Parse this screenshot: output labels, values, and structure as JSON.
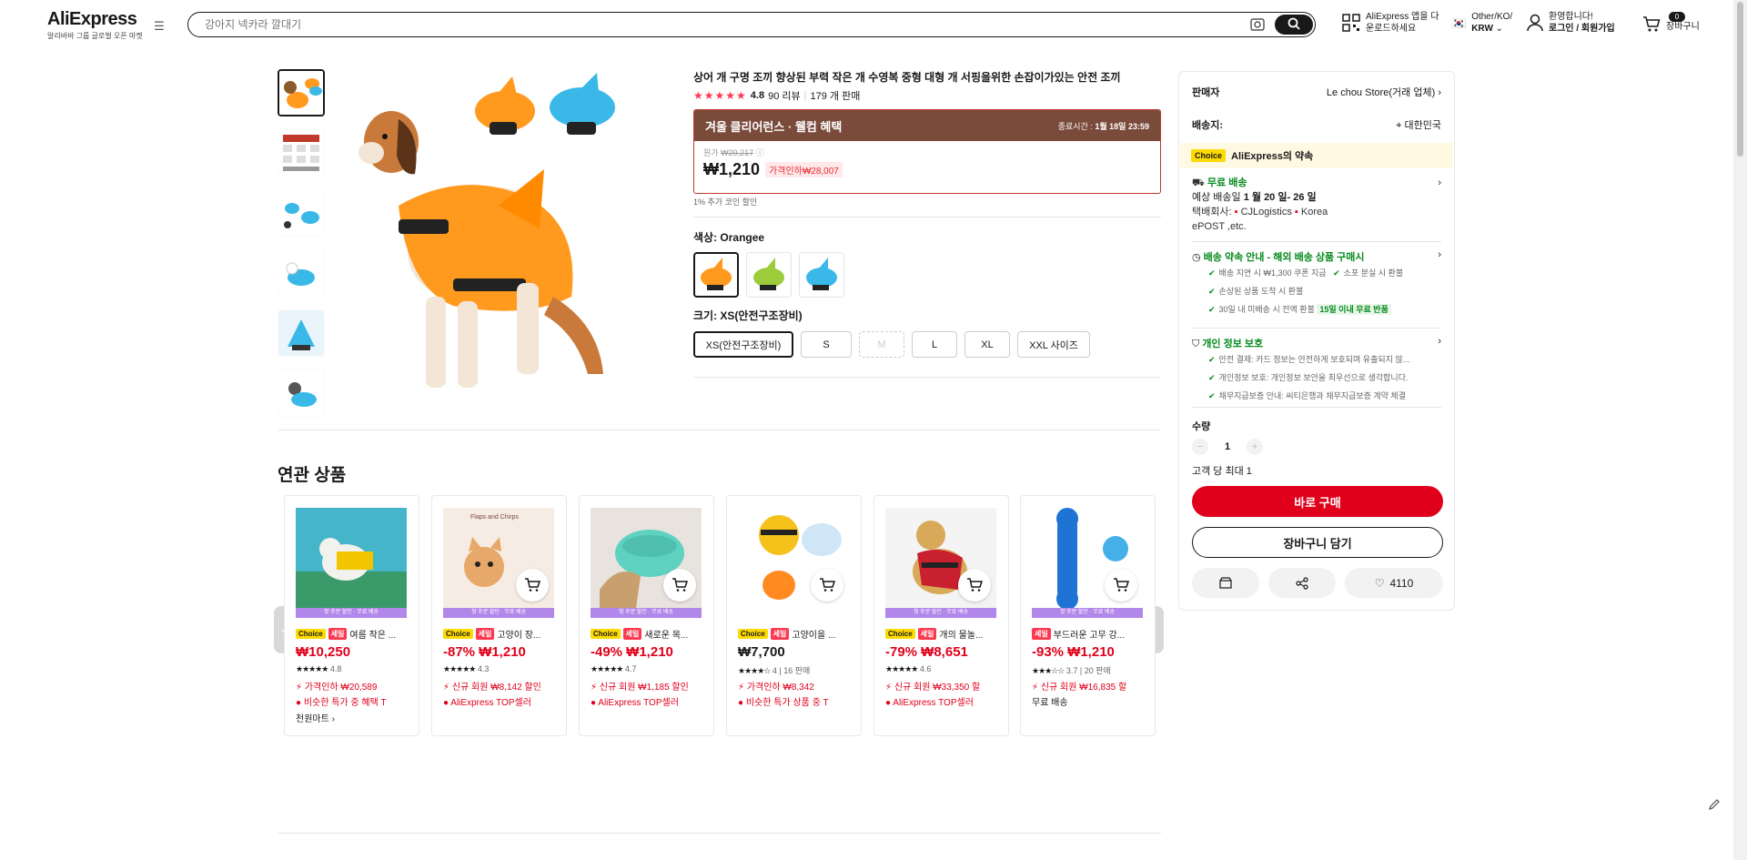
{
  "header": {
    "logo": "AliExpress",
    "logo_sub": "알리바바 그룹 글로벌 오픈 마켓",
    "search_placeholder": "강아지 넥카라 깔대기",
    "app_line1": "AliExpress 앱을 다",
    "app_line2": "운로드하세요",
    "region_line1": "Other/KO/",
    "region_line2": "KRW",
    "welcome": "환영합니다!",
    "login": "로그인 / 회원가입",
    "cart_count": "0",
    "cart_label": "장바구니"
  },
  "product": {
    "title": "상어 개 구명 조끼 향상된 부력 작은 개 수영복 중형 대형 개 서핑을위한 손잡이가있는 안전 조끼",
    "rating": "4.8",
    "reviews": "90 리뷰",
    "sold": "179 개 판매",
    "sale_title": "겨울 클리어런스 · 웰컴 혜택",
    "sale_end_label": "종료시간 :",
    "sale_end": "1월 18일 23:59",
    "orig_label": "원가",
    "orig_price": "₩29,217",
    "price": "₩1,210",
    "discount": "가격인하₩28,007",
    "coin": "1% 추가 코인 할인",
    "color_label": "색상: Orangee",
    "size_label": "크기: XS(안전구조장비)",
    "sizes": [
      "XS(안전구조장비)",
      "S",
      "M",
      "L",
      "XL",
      "XXL 사이즈"
    ]
  },
  "panel": {
    "seller_label": "판매자",
    "seller": "Le chou Store(거래 업체)",
    "ship_label": "배송지:",
    "ship_to": "대한민국",
    "choice": "Choice",
    "promise": "AliExpress의 약속",
    "free_ship": "무료 배송",
    "eta_label": "예상 배송일",
    "eta": "1 월 20 일- 26 일",
    "courier_label": "택배회사:",
    "courier1": "CJLogistics",
    "courier2": "Korea",
    "courier3": "ePOST ,etc.",
    "delivery_title": "배송 약속 안내 - 해외 배송 상품 구매시",
    "delivery_items": [
      "배송 지연 시 ₩1,300 쿠폰 지급",
      "소포 분실 시 환불",
      "손상된 상품 도착 시 환불",
      "30일 내 미배송 시 전액 환불"
    ],
    "free_return": "15일 이내 무료 반품",
    "privacy_title": "개인 정보 보호",
    "privacy_items": [
      "안전 결제: 카드 정보는 안전하게 보호되며 유출되지 않...",
      "개인정보 보호: 개인정보 보안을 최우선으로 생각합니다.",
      "채무지급보증 안내: 씨티은행과 채무지급보증 계약 체결"
    ],
    "qty_label": "수량",
    "qty": "1",
    "limit": "고객 당 최대 1",
    "buy": "바로 구매",
    "add_cart": "장바구니 담기",
    "likes": "4110"
  },
  "related": {
    "title": "연관 상품",
    "band": "첫 주문 할인 · 무료 배송",
    "cards": [
      {
        "choice": "Choice",
        "sale": "세일",
        "name": "여름 작은 ...",
        "price": "₩10,250",
        "stars": "★★★★★",
        "rating": "4.8",
        "sold": "",
        "l1": "가격인하 ₩20,589",
        "l2": "비슷한 특가 중 혜택 T",
        "l3": "천원마트"
      },
      {
        "choice": "Choice",
        "sale": "세일",
        "name": "고양이 장...",
        "price": "-87% ₩1,210",
        "stars": "★★★★★",
        "rating": "4.3",
        "sold": "",
        "l1": "신규 회원 ₩8,142 할인",
        "l2": "AliExpress TOP셀러",
        "l3": ""
      },
      {
        "choice": "Choice",
        "sale": "세일",
        "name": "새로운 목...",
        "price": "-49% ₩1,210",
        "stars": "★★★★★",
        "rating": "4.7",
        "sold": "",
        "l1": "신규 회원 ₩1,185 할인",
        "l2": "AliExpress TOP셀러",
        "l3": ""
      },
      {
        "choice": "Choice",
        "sale": "세일",
        "name": "고양이을 ...",
        "price": "₩7,700",
        "stars": "★★★★☆",
        "rating": "4",
        "sold": "| 16 판매",
        "l1": "가격인하 ₩8,342",
        "l2": "비슷한 특가 상품 중 T",
        "l3": ""
      },
      {
        "choice": "Choice",
        "sale": "세일",
        "name": "개의 물놀...",
        "price": "-79% ₩8,651",
        "stars": "★★★★★",
        "rating": "4.6",
        "sold": "",
        "l1": "신규 회원 ₩33,350 할",
        "l2": "AliExpress TOP셀러",
        "l3": ""
      },
      {
        "choice": "",
        "sale": "세일",
        "name": "부드러운 고무 강...",
        "price": "-93% ₩1,210",
        "stars": "★★★☆☆",
        "rating": "3.7",
        "sold": "| 20 판매",
        "l1": "신규 회원 ₩16,835 할",
        "l2": "무료 배송",
        "l3": ""
      }
    ]
  }
}
